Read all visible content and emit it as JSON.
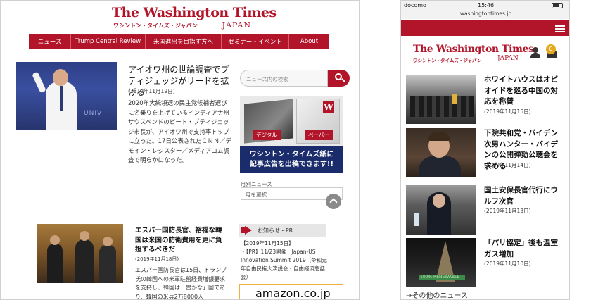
{
  "desktop": {
    "logo": {
      "wordmark": "The Washington Times",
      "kana": "ワシントン・タイムズ・ジャパン",
      "japan": "JAPAN"
    },
    "nav": [
      {
        "label": "ニュース"
      },
      {
        "label": "Trump Central Review"
      },
      {
        "label": "米国進出を目指す方へ"
      },
      {
        "label": "セミナー・イベント"
      },
      {
        "label": "About"
      }
    ],
    "article1": {
      "title": "アイオワ州の世論調査でブティジェッジがリードを拡げる",
      "date": "(2019年11月19日)",
      "body": "2020年大統領選の民主党候補者選びに名乗りを上げているインディアナ州サウスベンドのピート・ブティジェッジ市長が、アイオワ州で支持率トップに立った。17日公表されたＣＮＮ／デモイン・レジスター／メディアコム調査で明らかになった。"
    },
    "search": {
      "placeholder": "ニュース内の検索"
    },
    "banner": {
      "tag_digital": "デジタル",
      "tag_paper": "ペーパー",
      "caption_line1": "ワシントン・タイムズ紙に",
      "caption_line2": "記事広告を出稿できます!!",
      "w_logo": "W"
    },
    "monthly": {
      "label": "月別ニュース",
      "select_value": "月を選択"
    },
    "article2": {
      "title": "エスパー国防長官、裕福な韓国は米国の防衛費用を更に負担するべきだ",
      "date": "(2019年11月18日)",
      "body": "エスパー国防長官は15日、トランプ氏の韓国への米軍駐留経費増額要求を支持し、韓国は「豊かな」国であり、韓国の米兵2万8000人"
    },
    "notice": {
      "label": "お知らせ・PR",
      "date": "【2019年11月15日】",
      "body": "・【PR】11/23開催　Japan-US Innovation Summit 2019（令和元年自由民権大演説会・自由経済懇話会）",
      "amazon": "amazon.co.jp"
    }
  },
  "mobile": {
    "status": {
      "carrier": "docomo",
      "time": "15:46",
      "battery_level": 0.7
    },
    "url": "washingtontimes.jp",
    "logo": {
      "wordmark": "The Washington Times",
      "kana": "ワシントン・タイムズ・ジャパン",
      "japan": "JAPAN"
    },
    "cart_count": "0",
    "articles": [
      {
        "title": "ホワイトハウスはオピオイドを巡る中国の対応を称賛",
        "date": "(2019年11月15日)"
      },
      {
        "title": "下院共和党・バイデン次男ハンター・バイデンの公開弾劾公聴会を求める",
        "date": "(2019年11月14日)"
      },
      {
        "title": "国土安保長官代行にウルフ次官",
        "date": "(2019年11月13日)"
      },
      {
        "title": "「パリ協定」後も温室ガス増加",
        "date": "(2019年11月10日)"
      }
    ],
    "thumb4_text": "100% RENEWABLE",
    "more_link": "→その他のニュース"
  },
  "colors": {
    "brand_red": "#b2152a",
    "banner_navy": "#1a2c6b"
  }
}
